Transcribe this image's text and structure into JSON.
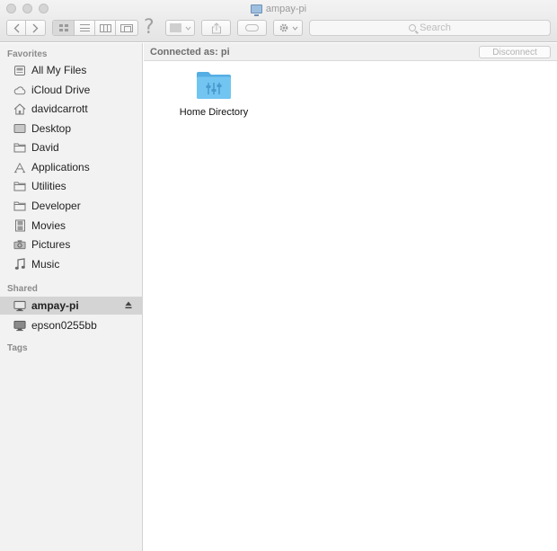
{
  "window": {
    "title": "ampay-pi",
    "title_icon": "monitor-icon"
  },
  "toolbar": {
    "back_icon": "chevron-left-icon",
    "forward_icon": "chevron-right-icon",
    "views": [
      {
        "name": "icon-view",
        "active": true
      },
      {
        "name": "list-view",
        "active": false
      },
      {
        "name": "column-view",
        "active": false
      },
      {
        "name": "cover-flow-view",
        "active": false
      }
    ],
    "help_glyph": "?",
    "search_placeholder": "Search"
  },
  "sidebar": {
    "favorites_header": "Favorites",
    "favorites": [
      {
        "label": "All My Files",
        "icon": "all-my-files-icon"
      },
      {
        "label": "iCloud Drive",
        "icon": "cloud-icon"
      },
      {
        "label": "davidcarrott",
        "icon": "home-icon"
      },
      {
        "label": "Desktop",
        "icon": "desktop-icon"
      },
      {
        "label": "David",
        "icon": "folder-icon"
      },
      {
        "label": "Applications",
        "icon": "applications-icon"
      },
      {
        "label": "Utilities",
        "icon": "folder-icon"
      },
      {
        "label": "Developer",
        "icon": "folder-icon"
      },
      {
        "label": "Movies",
        "icon": "film-icon"
      },
      {
        "label": "Pictures",
        "icon": "camera-icon"
      },
      {
        "label": "Music",
        "icon": "music-note-icon"
      }
    ],
    "shared_header": "Shared",
    "shared": [
      {
        "label": "ampay-pi",
        "icon": "monitor-icon",
        "selected": true
      },
      {
        "label": "epson0255bb",
        "icon": "monitor-icon",
        "selected": false
      }
    ],
    "tags_header": "Tags"
  },
  "main": {
    "connected_label": "Connected as: pi",
    "disconnect_label": "Disconnect",
    "items": [
      {
        "label": "Home Directory",
        "icon": "shared-folder-icon"
      }
    ]
  },
  "colors": {
    "folder_blue": "#6ec3ef",
    "sidebar_bg": "#f2f2f2",
    "selected_bg": "#d4d4d4"
  }
}
